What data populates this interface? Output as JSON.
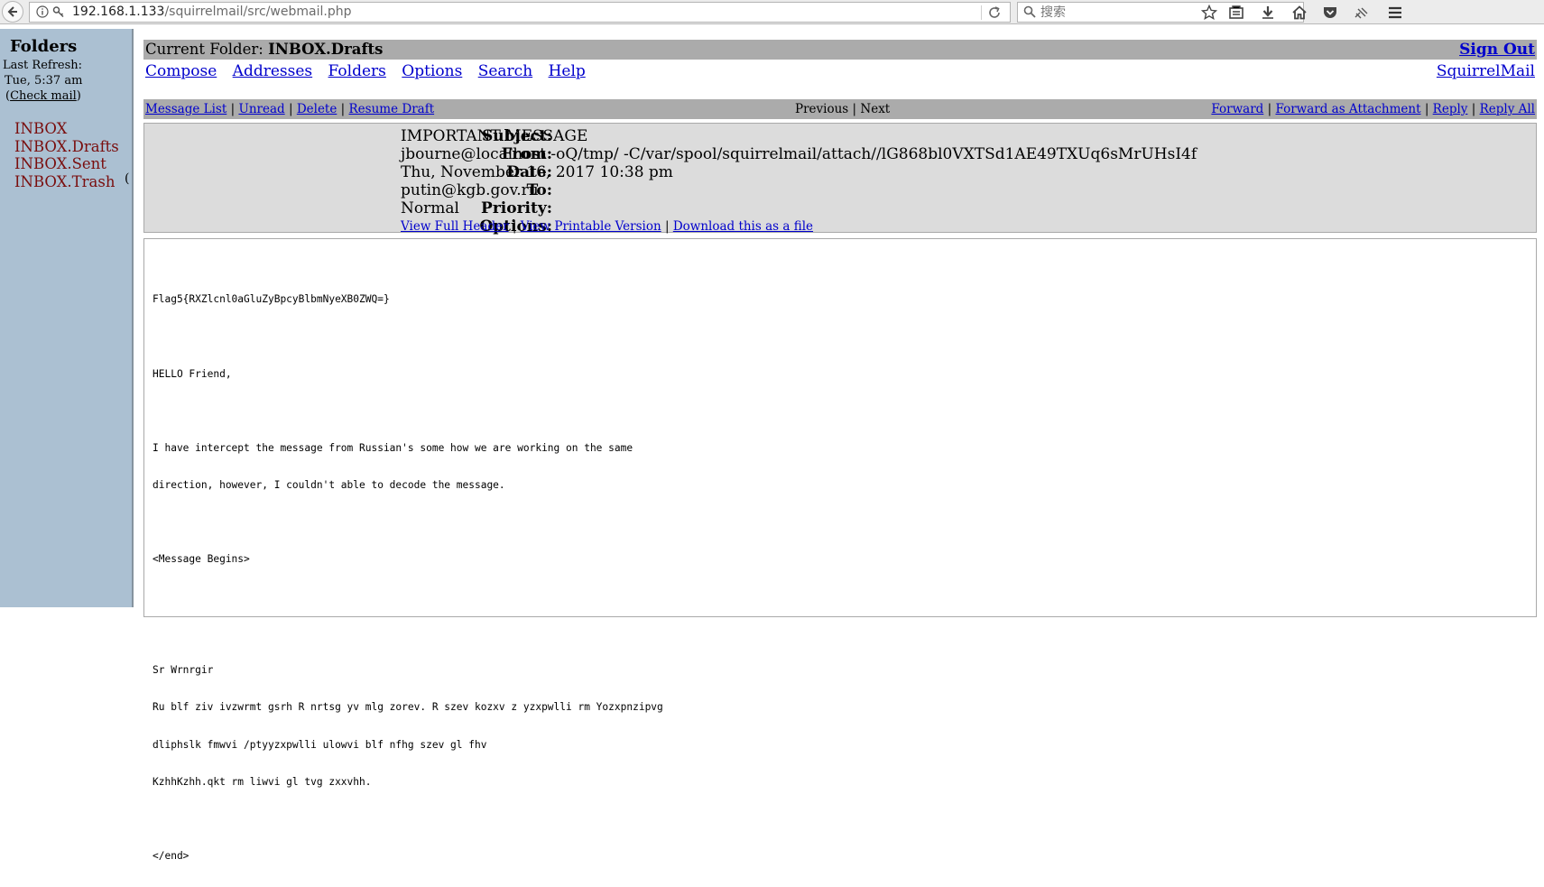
{
  "browser": {
    "url_host": "192.168.1.133",
    "url_path": "/squirrelmail/src/webmail.php",
    "search_placeholder": "搜索"
  },
  "sidebar": {
    "title": "Folders",
    "last_refresh_label": "Last Refresh:",
    "last_refresh_time": "Tue, 5:37 am",
    "check_mail_open": "(",
    "check_mail_label": "Check mail",
    "check_mail_close": ")",
    "folders": [
      "INBOX",
      "INBOX.Drafts",
      "INBOX.Sent",
      "INBOX.Trash"
    ],
    "trash_count_fragment": "("
  },
  "header": {
    "current_folder_label": "Current Folder:",
    "current_folder_name": "INBOX.Drafts",
    "sign_out": "Sign Out",
    "brand": "SquirrelMail",
    "menu": [
      "Compose",
      "Addresses",
      "Folders",
      "Options",
      "Search",
      "Help"
    ]
  },
  "actions": {
    "message_list": "Message List",
    "unread": "Unread",
    "delete": "Delete",
    "resume_draft": "Resume Draft",
    "previous": "Previous",
    "next": "Next",
    "forward": "Forward",
    "forward_attachment": "Forward as Attachment",
    "reply": "Reply",
    "reply_all": "Reply All"
  },
  "message": {
    "subject_label": "Subject:",
    "subject": "IMPORTANT MESSAGE",
    "from_label": "From:",
    "from": "jbourne@localhost -oQ/tmp/ -C/var/spool/squirrelmail/attach//lG868bl0VXTSd1AE49TXUq6sMrUHsI4f",
    "date_label": "Date:",
    "date": "Thu, November 16, 2017 10:38 pm",
    "to_label": "To:",
    "to": "putin@kgb.gov.ru",
    "priority_label": "Priority:",
    "priority": "Normal",
    "options_label": "Options:",
    "view_full_header": "View Full Header",
    "view_printable": "View Printable Version",
    "download_file": "Download this as a file",
    "body_lines": [
      "Flag5{RXZlcnl0aGluZyBpcyBlbmNyeXB0ZWQ=}",
      "",
      "HELLO Friend,",
      "",
      "I have intercept the message from Russian's some how we are working on the same",
      "direction, however, I couldn't able to decode the message.",
      "",
      "<Message Begins>",
      "",
      "",
      "Sr Wrnrgir",
      "Ru blf ziv ivzwrmt gsrh R nrtsg yv mlg zorev. R szev kozxv z yzxpwlli rm Yozxpnzipvg",
      "dliphslk fmwvi /ptyyzxpwlli ulowvi blf nfhg szev gl fhv",
      "KzhhKzhh.qkt rm liwvi gl tvg zxxvhh.",
      "",
      "</end>"
    ]
  }
}
